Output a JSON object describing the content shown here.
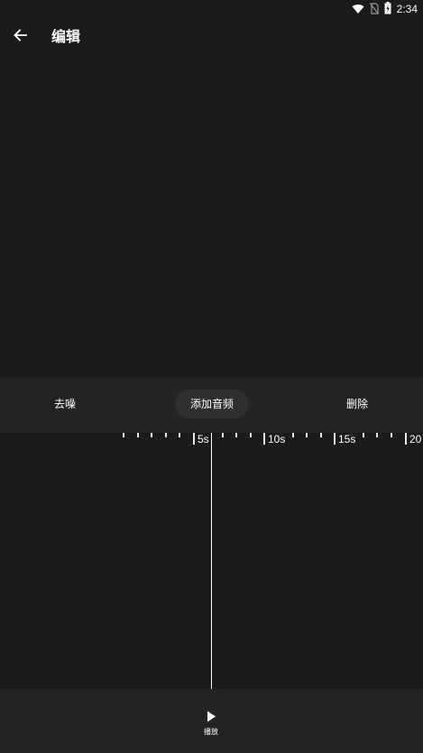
{
  "status_bar": {
    "time": "2:34",
    "icons": [
      "wifi-icon",
      "no-sim-icon",
      "battery-charging-icon"
    ]
  },
  "app_bar": {
    "back_icon": "arrow-left-icon",
    "title": "编辑"
  },
  "toolbar": {
    "denoise_label": "去噪",
    "add_audio_label": "添加音频",
    "delete_label": "删除"
  },
  "timeline": {
    "ruler_labels": [
      "5s",
      "10s",
      "15s",
      "20"
    ]
  },
  "bottom_bar": {
    "play_icon": "play-icon",
    "play_label": "播放"
  },
  "colors": {
    "background": "#1b1b1b",
    "panel": "#232323",
    "pill": "#2f2f2f",
    "text": "#ffffff"
  }
}
